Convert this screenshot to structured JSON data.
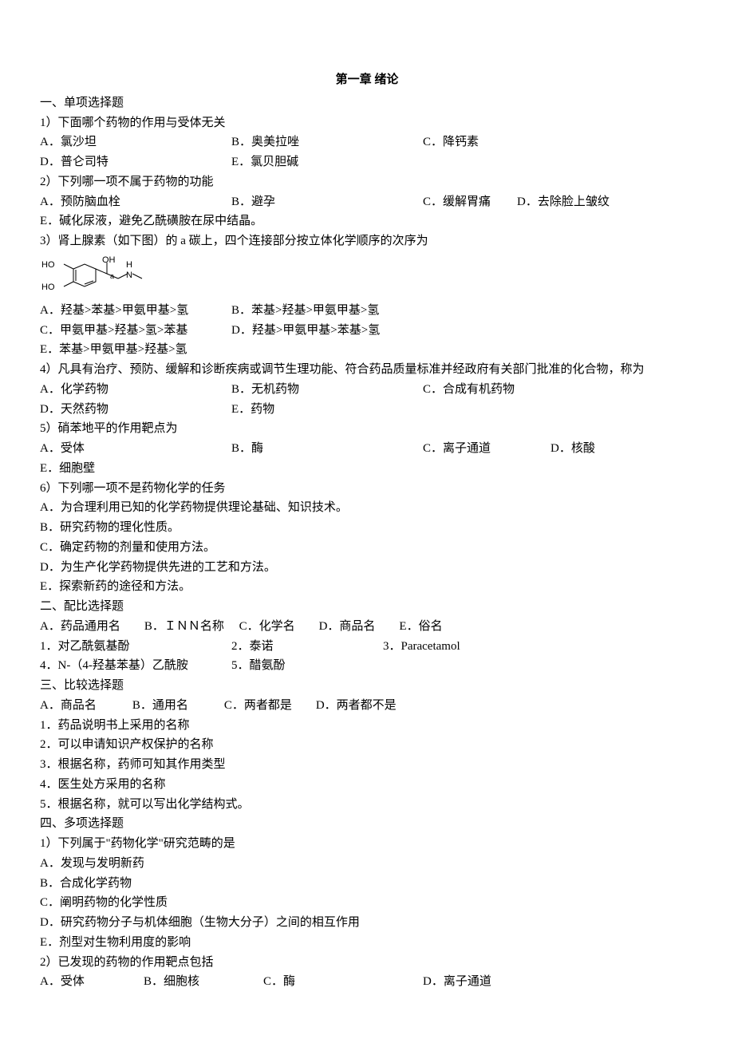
{
  "title": "第一章 绪论",
  "s1": {
    "heading": "一、单项选择题",
    "q1": {
      "stem": "1）下面哪个药物的作用与受体无关",
      "A": "A．氯沙坦",
      "B": "B．奥美拉唑",
      "C": "C．降钙素",
      "D": "D．普仑司特",
      "E": "E．氯贝胆碱"
    },
    "q2": {
      "stem": "2）下列哪一项不属于药物的功能",
      "A": "A．预防脑血栓",
      "B": "B．避孕",
      "C": "C．缓解胃痛",
      "D": "D．去除脸上皱纹",
      "E": "E．碱化尿液，避免乙酰磺胺在尿中结晶。"
    },
    "q3": {
      "stem": "3）肾上腺素（如下图）的 a 碳上，四个连接部分按立体化学顺序的次序为",
      "A": "A．羟基>苯基>甲氨甲基>氢",
      "B": "B．苯基>羟基>甲氨甲基>氢",
      "C": "C．甲氨甲基>羟基>氢>苯基",
      "D": "D．羟基>甲氨甲基>苯基>氢",
      "E": "E．苯基>甲氨甲基>羟基>氢"
    },
    "q4": {
      "stem": "4）凡具有治疗、预防、缓解和诊断疾病或调节生理功能、符合药品质量标准并经政府有关部门批准的化合物，称为",
      "A": "A．化学药物",
      "B": "B．无机药物",
      "C": "C．合成有机药物",
      "D": "D．天然药物",
      "E": "E．药物"
    },
    "q5": {
      "stem": "5）硝苯地平的作用靶点为",
      "A": "A．受体",
      "B": "B．酶",
      "C": "C．离子通道",
      "D": "D．核酸",
      "E": "E．细胞壁"
    },
    "q6": {
      "stem": "6）下列哪一项不是药物化学的任务",
      "A": "A．为合理利用已知的化学药物提供理论基础、知识技术。",
      "B": "B．研究药物的理化性质。",
      "C": "C．确定药物的剂量和使用方法。",
      "D": "D．为生产化学药物提供先进的工艺和方法。",
      "E": "E．探索新药的途径和方法。"
    }
  },
  "s2": {
    "heading": "二、配比选择题",
    "opts": "A．药品通用名　　B．ＩＮＮ名称　 C．化学名　　D．商品名　　E．俗名",
    "i1": "1．对乙酰氨基酚",
    "i2": "2．泰诺",
    "i3": "3．Paracetamol",
    "i4": "4．N-（4-羟基苯基）乙酰胺",
    "i5": "5．醋氨酚"
  },
  "s3": {
    "heading": "三、比较选择题",
    "opts": "A．商品名　　　B．通用名　　　C．两者都是　　D．两者都不是",
    "i1": "1．药品说明书上采用的名称",
    "i2": "2．可以申请知识产权保护的名称",
    "i3": "3．根据名称，药师可知其作用类型",
    "i4": "4．医生处方采用的名称",
    "i5": "5．根据名称，就可以写出化学结构式。"
  },
  "s4": {
    "heading": "四、多项选择题",
    "q1": {
      "stem": "1）下列属于\"药物化学\"研究范畴的是",
      "A": "A．发现与发明新药",
      "B": "B．合成化学药物",
      "C": "C．阐明药物的化学性质",
      "D": "D．研究药物分子与机体细胞（生物大分子）之间的相互作用",
      "E": "E．剂型对生物利用度的影响"
    },
    "q2": {
      "stem": "2）已发现的药物的作用靶点包括",
      "A": "A．受体",
      "B": "B．细胞核",
      "C": "C．酶",
      "D": "D．离子通道"
    }
  }
}
